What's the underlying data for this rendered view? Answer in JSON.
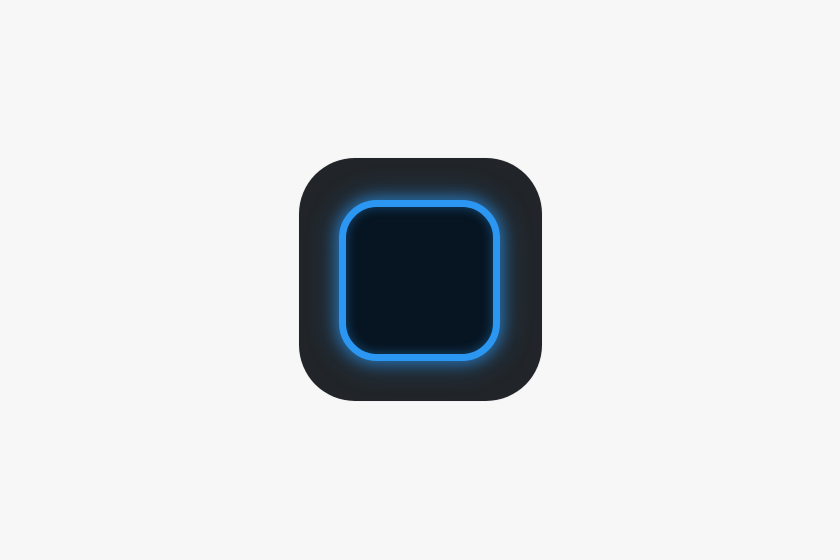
{
  "app_icon": {
    "icon": "widget-square-icon",
    "colors": {
      "background": "#f7f7f7",
      "tile": "#212529",
      "frame": "#2b97f2",
      "inner": "#071522"
    }
  }
}
